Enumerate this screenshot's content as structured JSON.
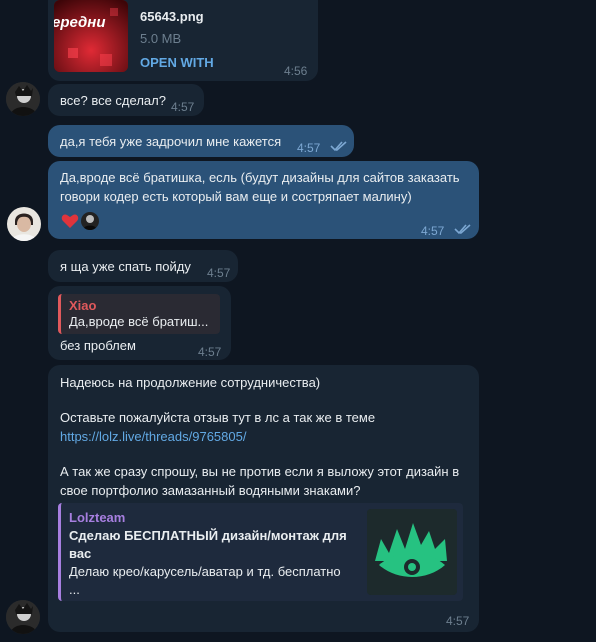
{
  "file_message": {
    "name": "65643.png",
    "size": "5.0 MB",
    "action": "OPEN WITH",
    "time": "4:56",
    "thumb_text": "ередни"
  },
  "messages": [
    {
      "text": "все? все сделал?",
      "time": "4:57"
    },
    {
      "text": "да,я тебя уже задрочил мне кажется",
      "time": "4:57"
    },
    {
      "line1": "Да,вроде всё братишка, есль (будут дизайны для сайтов заказать",
      "line2": "говори кодер есть который вам еще и состряпает малину)",
      "time": "4:57"
    },
    {
      "text": "я ща уже спать пойду",
      "time": "4:57"
    },
    {
      "reply_name": "Xiao",
      "reply_snippet": "Да,вроде всё братиш...",
      "text": "без проблем",
      "time": "4:57"
    }
  ],
  "last_message": {
    "line1": "Надеюсь на продолжение сотрудничества)",
    "line2": "Оставьте пожалуйста отзыв тут в лс а так же в теме",
    "link": "https://lolz.live/threads/9765805/",
    "line3": "А так же сразу спрошу, вы не против если я выложу этот дизайн в",
    "line4": "свое портфолио замазанный водяными знаками?",
    "time": "4:57",
    "preview": {
      "site": "Lolzteam",
      "title": "Сделаю БЕСПЛАТНЫЙ дизайн/монтаж для вас",
      "description": "Делаю крео/карусель/аватар и тд. бесплатно\n..."
    }
  },
  "colors": {
    "background": "#0e1621",
    "incoming_bubble": "#182533",
    "outgoing_bubble": "#2b5278",
    "link": "#62a9e4",
    "reply_accent": "#e0595c",
    "preview_accent": "#a77fe0"
  }
}
